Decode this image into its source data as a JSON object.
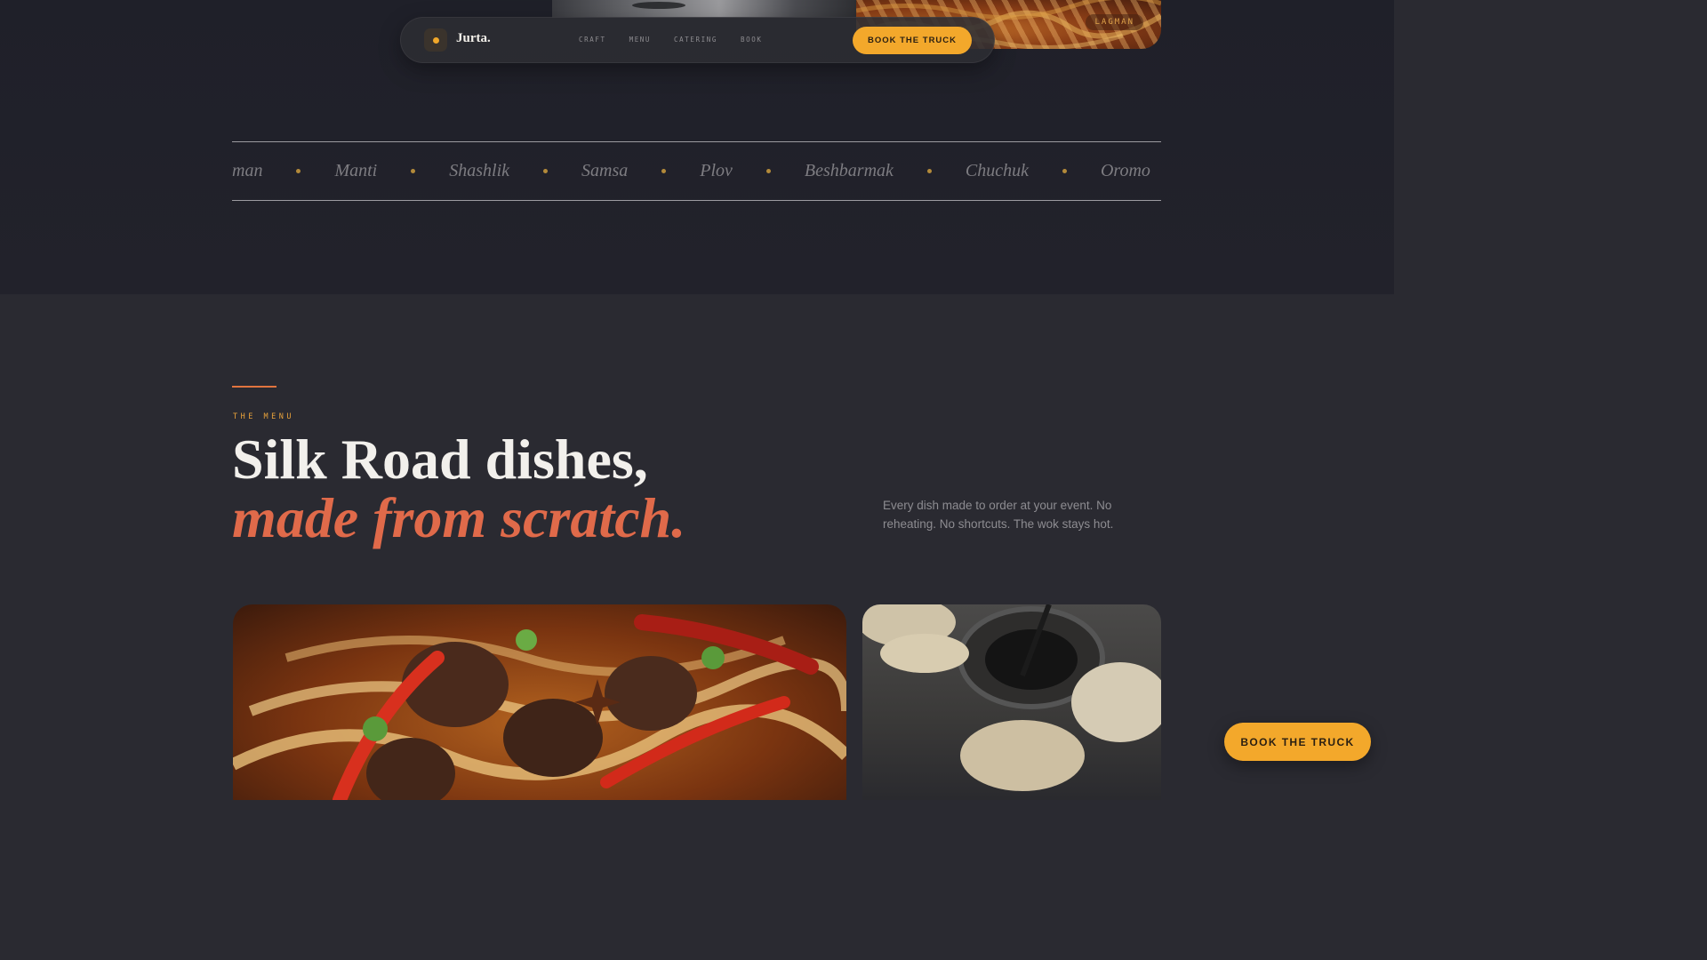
{
  "hero": {
    "tag_label": "LAGMAN"
  },
  "nav": {
    "brand": "Jurta.",
    "links": [
      "CRAFT",
      "MENU",
      "CATERING",
      "BOOK"
    ],
    "cta_label": "BOOK THE TRUCK"
  },
  "marquee": {
    "items": [
      "man",
      "Manti",
      "Shashlik",
      "Samsa",
      "Plov",
      "Beshbarmak",
      "Chuchuk",
      "Oromo"
    ]
  },
  "menu_section": {
    "eyebrow": "THE MENU",
    "headline": "Silk Road dishes,",
    "headline_accent": "made from scratch.",
    "description": "Every dish made to order at your event. No reheating. No shortcuts. The wok stays hot."
  },
  "floating_cta": {
    "label": "BOOK THE TRUCK"
  },
  "colors": {
    "accent_orange": "#f3a82b",
    "accent_coral": "#e06a4a",
    "background": "#2a2a31"
  }
}
